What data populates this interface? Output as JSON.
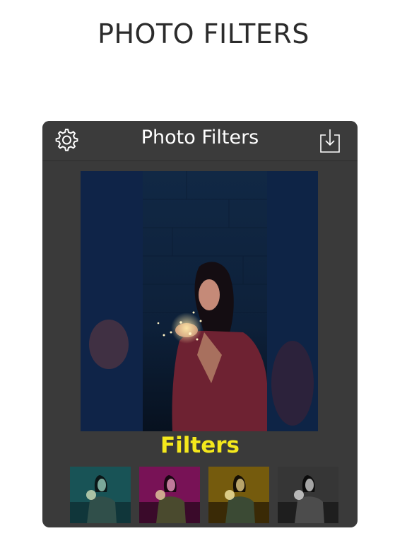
{
  "page": {
    "title": "PHOTO FILTERS"
  },
  "app": {
    "title": "Photo Filters",
    "icons": {
      "settings": "gear-icon",
      "download": "download-icon"
    }
  },
  "filters": {
    "label": "Filters",
    "label_color": "#f4e81c",
    "items": [
      {
        "name": "teal",
        "tint": "#1f6f74"
      },
      {
        "name": "magenta",
        "tint": "#a01a70"
      },
      {
        "name": "amber",
        "tint": "#9a7a12"
      },
      {
        "name": "mono",
        "tint": "#5a5a5a"
      }
    ]
  }
}
